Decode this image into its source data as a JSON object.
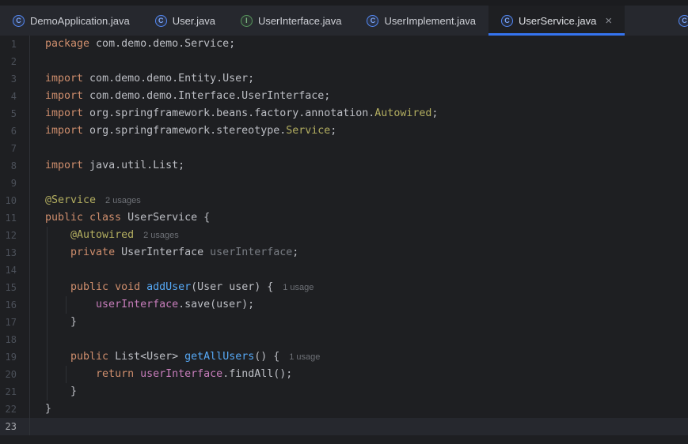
{
  "icons": {
    "class_letter": "C",
    "interface_letter": "I"
  },
  "tabs": [
    {
      "label": "DemoApplication.java",
      "type": "class",
      "active": false
    },
    {
      "label": "User.java",
      "type": "class",
      "active": false
    },
    {
      "label": "UserInterface.java",
      "type": "interface",
      "active": false
    },
    {
      "label": "UserImplement.java",
      "type": "class",
      "active": false
    },
    {
      "label": "UserService.java",
      "type": "class",
      "active": true,
      "close_glyph": "×"
    },
    {
      "label": "",
      "type": "class",
      "partial": true
    }
  ],
  "code": {
    "lines": [
      {
        "n": 1,
        "seg": [
          [
            "kw",
            "package"
          ],
          [
            "pl",
            " com.demo.demo.Service;"
          ]
        ]
      },
      {
        "n": 2,
        "seg": []
      },
      {
        "n": 3,
        "seg": [
          [
            "kw",
            "import"
          ],
          [
            "pl",
            " com.demo.demo.Entity.User;"
          ]
        ]
      },
      {
        "n": 4,
        "seg": [
          [
            "kw",
            "import"
          ],
          [
            "pl",
            " com.demo.demo.Interface.UserInterface;"
          ]
        ]
      },
      {
        "n": 5,
        "seg": [
          [
            "kw",
            "import"
          ],
          [
            "pl",
            " org.springframework.beans.factory.annotation."
          ],
          [
            "ann",
            "Autowired"
          ],
          [
            "pl",
            ";"
          ]
        ]
      },
      {
        "n": 6,
        "seg": [
          [
            "kw",
            "import"
          ],
          [
            "pl",
            " org.springframework.stereotype."
          ],
          [
            "ann",
            "Service"
          ],
          [
            "pl",
            ";"
          ]
        ]
      },
      {
        "n": 7,
        "seg": []
      },
      {
        "n": 8,
        "seg": [
          [
            "kw",
            "import"
          ],
          [
            "pl",
            " java.util.List;"
          ]
        ]
      },
      {
        "n": 9,
        "seg": []
      },
      {
        "n": 10,
        "seg": [
          [
            "ann",
            "@Service"
          ]
        ],
        "hint": "2 usages"
      },
      {
        "n": 11,
        "seg": [
          [
            "kw",
            "public class"
          ],
          [
            "pl",
            " UserService {"
          ]
        ]
      },
      {
        "n": 12,
        "seg": [
          [
            "pl",
            "    "
          ],
          [
            "ann",
            "@Autowired"
          ]
        ],
        "hint": "2 usages"
      },
      {
        "n": 13,
        "seg": [
          [
            "pl",
            "    "
          ],
          [
            "kw",
            "private"
          ],
          [
            "pl",
            " UserInterface "
          ],
          [
            "dim",
            "userInterface"
          ],
          [
            "pl",
            ";"
          ]
        ]
      },
      {
        "n": 14,
        "seg": []
      },
      {
        "n": 15,
        "seg": [
          [
            "pl",
            "    "
          ],
          [
            "kw",
            "public void"
          ],
          [
            "pl",
            " "
          ],
          [
            "fn",
            "addUser"
          ],
          [
            "pl",
            "(User user) {"
          ]
        ],
        "hint": "1 usage"
      },
      {
        "n": 16,
        "seg": [
          [
            "pl",
            "        "
          ],
          [
            "fld",
            "userInterface"
          ],
          [
            "pl",
            ".save(user);"
          ]
        ]
      },
      {
        "n": 17,
        "seg": [
          [
            "pl",
            "    }"
          ]
        ]
      },
      {
        "n": 18,
        "seg": []
      },
      {
        "n": 19,
        "seg": [
          [
            "pl",
            "    "
          ],
          [
            "kw",
            "public"
          ],
          [
            "pl",
            " List<User> "
          ],
          [
            "fn",
            "getAllUsers"
          ],
          [
            "pl",
            "() {"
          ]
        ],
        "hint": "1 usage"
      },
      {
        "n": 20,
        "seg": [
          [
            "pl",
            "        "
          ],
          [
            "kw",
            "return"
          ],
          [
            "pl",
            " "
          ],
          [
            "fld",
            "userInterface"
          ],
          [
            "pl",
            ".findAll();"
          ]
        ]
      },
      {
        "n": 21,
        "seg": [
          [
            "pl",
            "    }"
          ]
        ]
      },
      {
        "n": 22,
        "seg": [
          [
            "pl",
            "}"
          ]
        ]
      },
      {
        "n": 23,
        "seg": [],
        "current": true
      }
    ]
  },
  "colors": {
    "accent": "#3574F0",
    "editor_bg": "#1E1F22",
    "tabbar_bg": "#26282E",
    "caret_line_bg": "#26282E",
    "keyword": "#CF8E6D",
    "plain_text": "#BCBEC4",
    "annotation": "#B3AE60",
    "method_declaration": "#56A8F5",
    "field_reference": "#C77DBB",
    "field_declaration_dim": "#787C83",
    "usage_hint": "#6E7177",
    "line_number": "#4B5059",
    "line_number_current": "#A6A8AD",
    "class_icon": "#548AF7",
    "interface_icon": "#57965C"
  }
}
